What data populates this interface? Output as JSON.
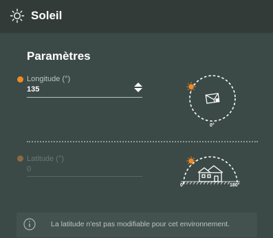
{
  "header": {
    "title": "Soleil",
    "icon": "sun-icon"
  },
  "section": {
    "title": "Paramètres"
  },
  "longitude": {
    "label": "Longitude (°)",
    "value": "135",
    "indicator_color": "#f08a24",
    "diagram": {
      "bottom_label": "0°",
      "icon": "compass-house-top-view-icon"
    }
  },
  "latitude": {
    "label": "Latitude (°)",
    "value": "0",
    "disabled": true,
    "indicator_color": "#8a6a44",
    "diagram": {
      "left_label": "0°",
      "right_label": "180°",
      "icon": "house-side-view-icon"
    }
  },
  "info": {
    "text": "La latitude n'est pas modifiable pour cet environnement.",
    "icon": "info-icon"
  },
  "colors": {
    "accent": "#f08a24",
    "background": "#3c4a47",
    "header": "#333b39"
  }
}
